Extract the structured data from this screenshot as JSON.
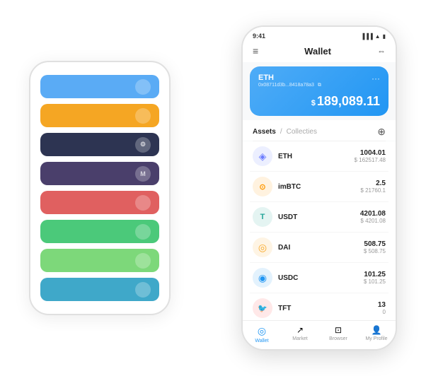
{
  "scene": {
    "bg_phone": {
      "cards": [
        {
          "color": "blue",
          "symbol": ""
        },
        {
          "color": "orange",
          "symbol": ""
        },
        {
          "color": "dark",
          "symbol": "⚙"
        },
        {
          "color": "purple",
          "symbol": "M"
        },
        {
          "color": "red",
          "symbol": ""
        },
        {
          "color": "green",
          "symbol": ""
        },
        {
          "color": "light-green",
          "symbol": ""
        },
        {
          "color": "teal",
          "symbol": ""
        }
      ]
    },
    "fg_phone": {
      "status": {
        "time": "9:41",
        "signal": "▐▐▐",
        "wifi": "▲",
        "battery": "▮"
      },
      "header": {
        "menu_icon": "≡",
        "title": "Wallet",
        "scan_icon": "⇔"
      },
      "wallet_card": {
        "eth_label": "ETH",
        "address": "0x08711d3b...8418a78a3",
        "copy_icon": "⧉",
        "more_icon": "···",
        "balance_symbol": "$",
        "balance": "189,089.11"
      },
      "assets": {
        "tab_active": "Assets",
        "slash": "/",
        "tab_inactive": "Collecties",
        "add_icon": "⊕",
        "items": [
          {
            "name": "ETH",
            "icon": "◈",
            "icon_color": "#6b7cff",
            "amount": "1004.01",
            "usd": "$ 162517.48"
          },
          {
            "name": "imBTC",
            "icon": "⊙",
            "icon_color": "#ff9800",
            "amount": "2.5",
            "usd": "$ 21760.1"
          },
          {
            "name": "USDT",
            "icon": "T",
            "icon_color": "#26a69a",
            "amount": "4201.08",
            "usd": "$ 4201.08"
          },
          {
            "name": "DAI",
            "icon": "◎",
            "icon_color": "#f9a825",
            "amount": "508.75",
            "usd": "$ 508.75"
          },
          {
            "name": "USDC",
            "icon": "◉",
            "icon_color": "#2196f3",
            "amount": "101.25",
            "usd": "$ 101.25"
          },
          {
            "name": "TFT",
            "icon": "🐦",
            "icon_color": "#ff4b4b",
            "amount": "13",
            "usd": "0"
          }
        ]
      },
      "nav": [
        {
          "label": "Wallet",
          "icon": "◎",
          "active": true
        },
        {
          "label": "Market",
          "icon": "↗",
          "active": false
        },
        {
          "label": "Browser",
          "icon": "⊡",
          "active": false
        },
        {
          "label": "My Profile",
          "icon": "👤",
          "active": false
        }
      ]
    }
  }
}
